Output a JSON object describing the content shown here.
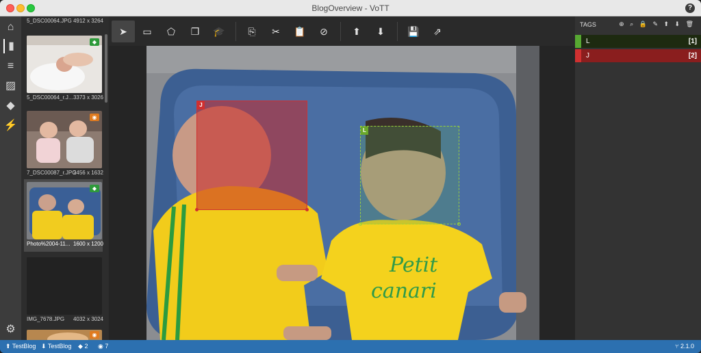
{
  "window": {
    "title": "BlogOverview - VoTT",
    "help_icon": "?"
  },
  "nav": [
    {
      "name": "home-icon",
      "glyph": "⌂"
    },
    {
      "name": "bookmark-icon",
      "glyph": "▮"
    },
    {
      "name": "settings-sliders-icon",
      "glyph": "≡"
    },
    {
      "name": "edit-image-icon",
      "glyph": "▨"
    },
    {
      "name": "graduation-cap-icon",
      "glyph": "◆"
    },
    {
      "name": "plug-icon",
      "glyph": "⚡"
    },
    {
      "name": "gear-icon",
      "glyph": "⚙"
    }
  ],
  "thumbnails": [
    {
      "name": "5_DSC00064.JPG",
      "size": "4912 x 3264",
      "badge": null
    },
    {
      "name": "5_DSC00064_r.J...",
      "size": "3373 x 3026",
      "badge": "tag"
    },
    {
      "name": "7_DSC00087_r.JPG",
      "size": "2456 x 1632",
      "badge": "visited"
    },
    {
      "name": "Photo%2004-11...",
      "size": "1600 x 1200",
      "badge": "tag",
      "selected": true
    },
    {
      "name": "IMG_7678.JPG",
      "size": "4032 x 3024",
      "badge": null
    },
    {
      "name": "",
      "size": "",
      "badge": "visited"
    }
  ],
  "toolbar": {
    "select": "➤",
    "rect": "▭",
    "polygon": "⬠",
    "copy_rect": "❐",
    "active_learning": "🎓",
    "copy": "⎘",
    "cut": "✂",
    "paste": "📋",
    "clear": "⊘",
    "prev": "⬆",
    "next": "⬇",
    "save": "💾",
    "export": "⇗"
  },
  "regions": [
    {
      "tag": "J",
      "color": "#d03030"
    },
    {
      "tag": "L",
      "color": "#6aa82a"
    }
  ],
  "tags_panel": {
    "header": "TAGS",
    "tools": "⊕ ⌕ 🔒 ✎ ⬆ ⬇ 🗑",
    "tags": [
      {
        "name": "L",
        "key": "[1]",
        "color": "#57a832",
        "bg": "#233012"
      },
      {
        "name": "J",
        "key": "[2]",
        "color": "#d03030",
        "bg": "#8a1e1e"
      }
    ]
  },
  "status": {
    "source": "TestBlog",
    "target": "TestBlog",
    "tagged": "2",
    "visited": "7",
    "version": "2.1.0"
  }
}
